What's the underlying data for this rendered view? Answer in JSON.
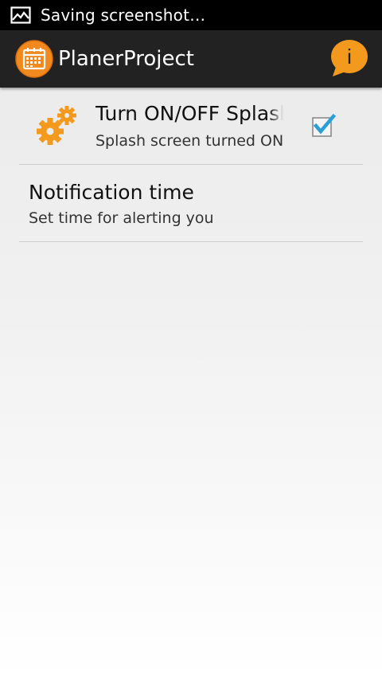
{
  "status_bar": {
    "notification_icon": "image-icon",
    "text": "Saving screenshot…",
    "background": "#000000"
  },
  "action_bar": {
    "title": "PlanerProject",
    "app_icon": "calendar-icon",
    "info_icon": "info-icon",
    "info_text": "i",
    "accent_color": "#f08a1e",
    "background": "#222222"
  },
  "preferences": [
    {
      "icon": "gears-icon",
      "title": "Turn ON/OFF Splash screen",
      "summary": "Splash screen turned ON",
      "checked": true
    },
    {
      "title": "Notification time",
      "summary": "Set time for alerting you"
    }
  ],
  "colors": {
    "checkbox_tick": "#2a9fd6",
    "gears": "#f39a1e",
    "divider": "#cfcfcf"
  }
}
